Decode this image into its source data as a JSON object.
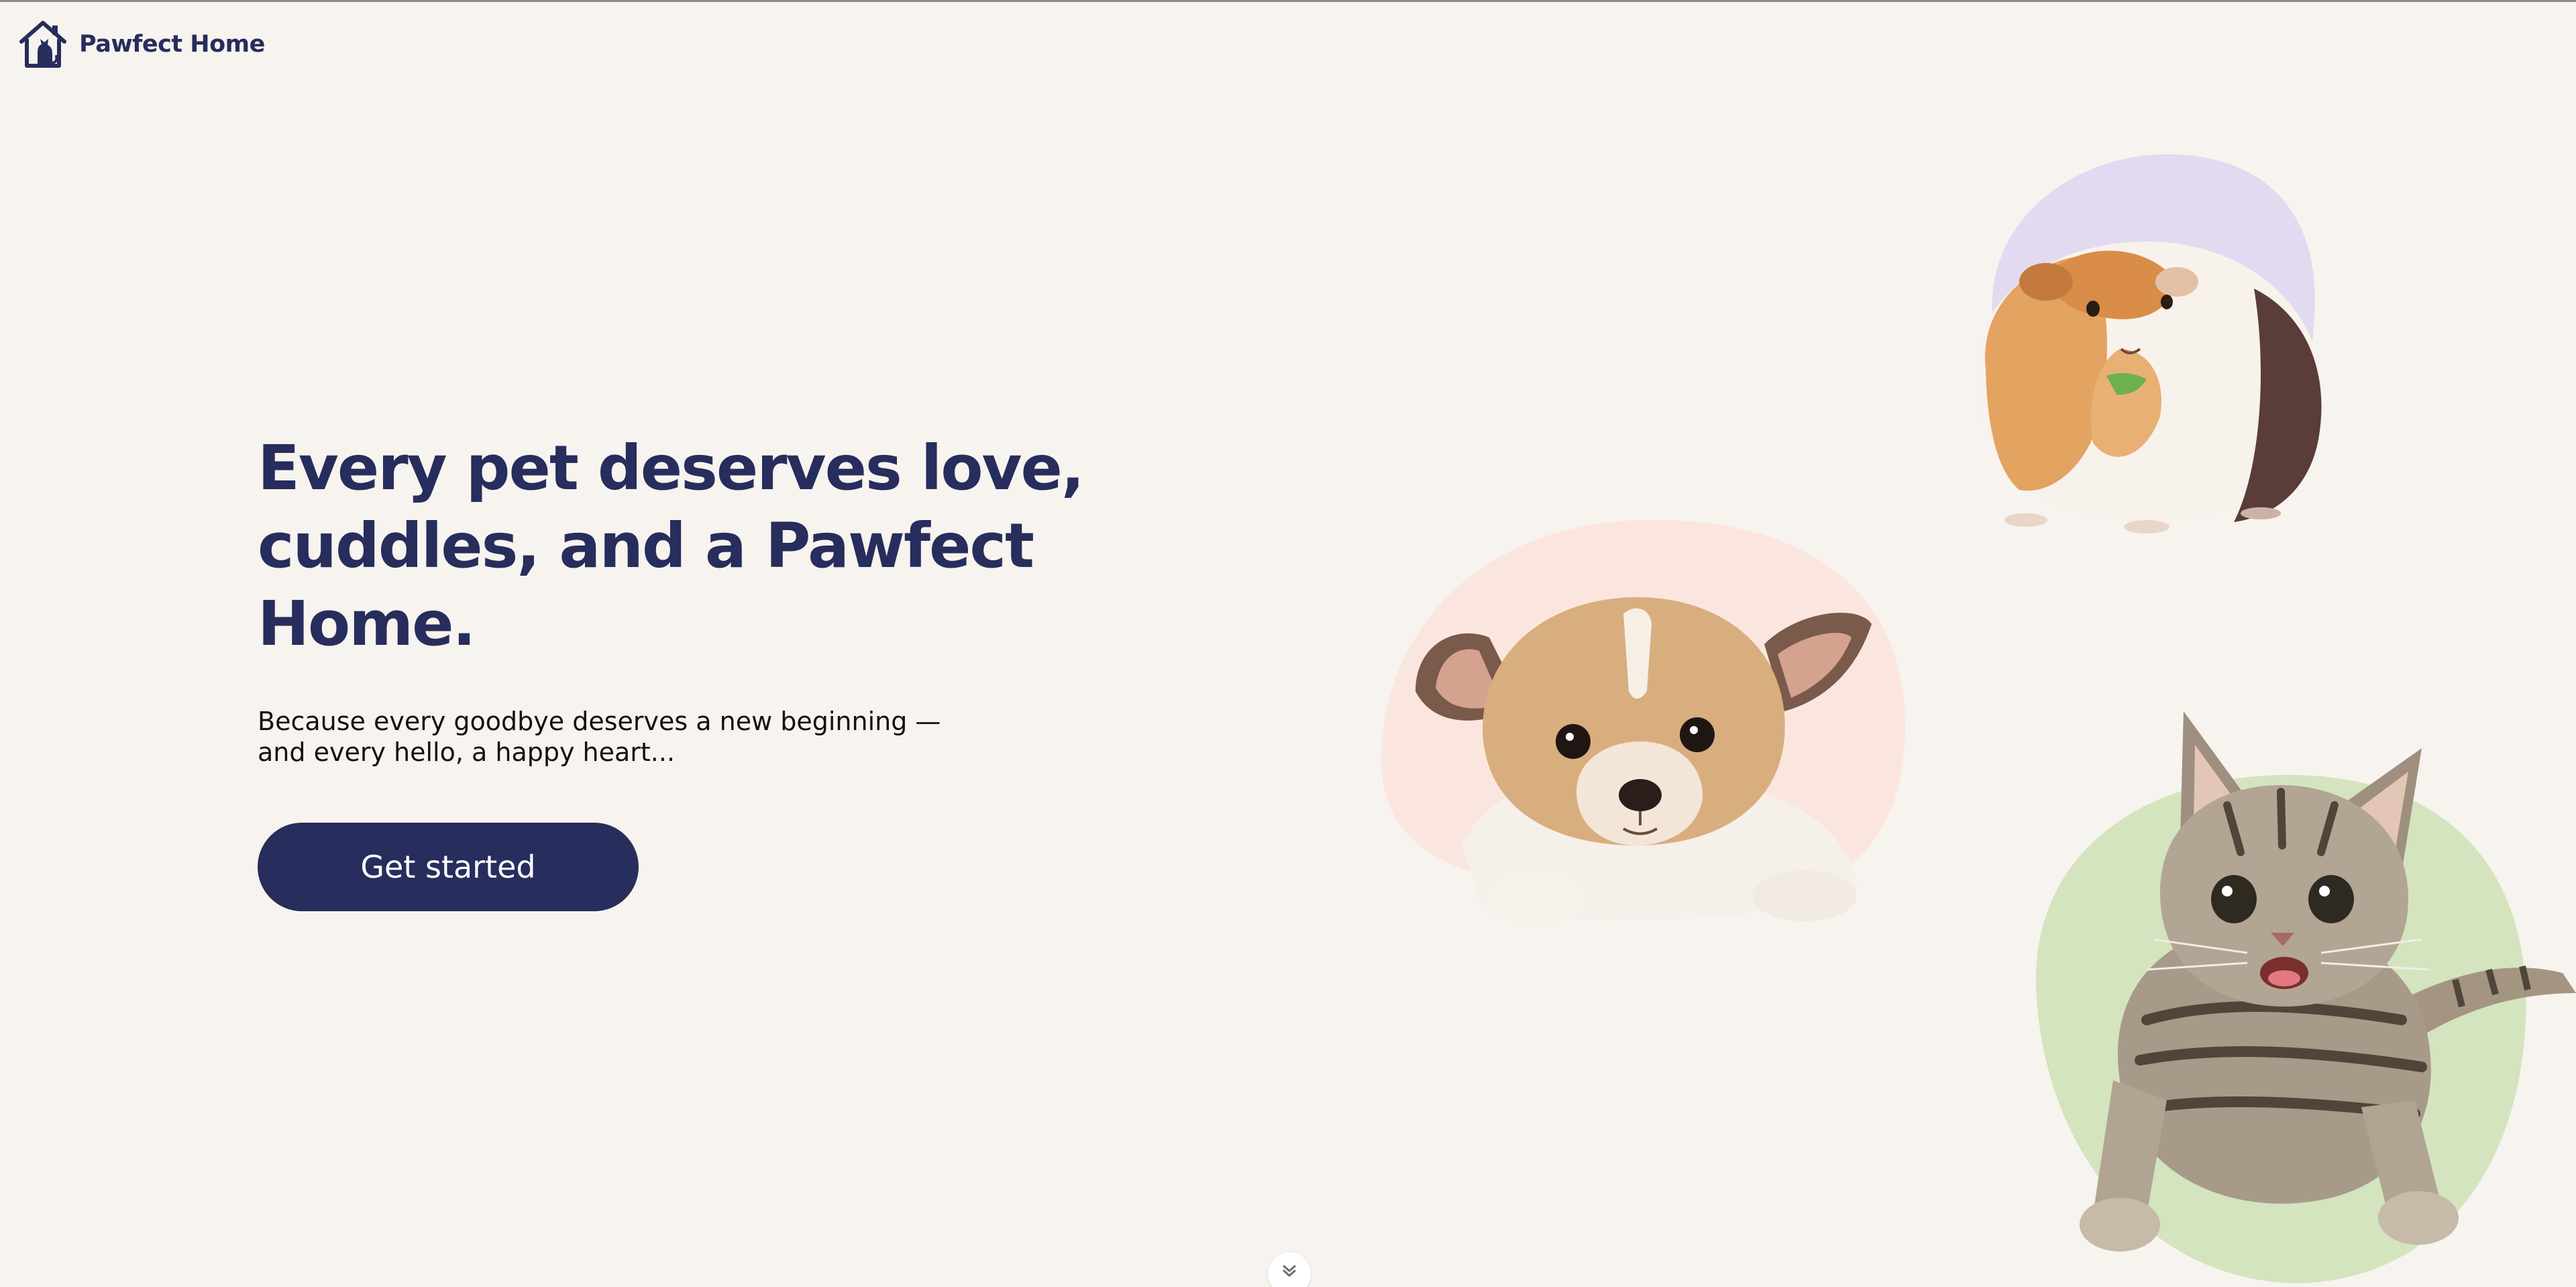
{
  "header": {
    "brand_name": "Pawfect Home",
    "logo_icon": "house-with-cat-icon"
  },
  "hero": {
    "title": "Every pet deserves love, cuddles, and a Pawfect Home.",
    "subtitle_lines": [
      "Because every goodbye deserves a new beginning —",
      "and every hello, a happy heart..."
    ],
    "cta_label": "Get started"
  },
  "pets": [
    {
      "name": "guinea-pig",
      "blob_color": "#e2daf0"
    },
    {
      "name": "puppy",
      "blob_color": "#fbe6df"
    },
    {
      "name": "tabby-cat",
      "blob_color": "#d3e4bf"
    }
  ],
  "scroll_hint": {
    "icon": "double-chevron-down-icon"
  },
  "colors": {
    "background": "#f7f3ee",
    "brand_navy": "#272d5c",
    "button_text": "#ffffff"
  }
}
